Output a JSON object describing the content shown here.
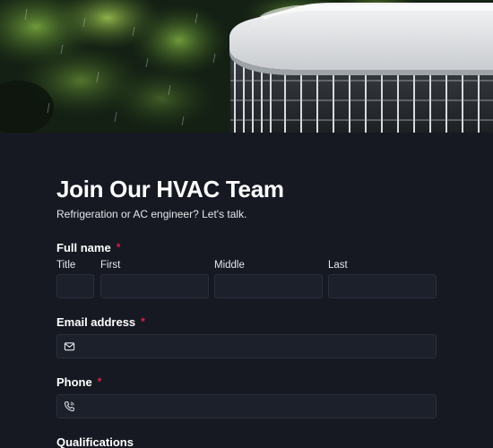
{
  "form": {
    "title": "Join Our HVAC Team",
    "subtitle": "Refrigeration or AC engineer? Let's talk.",
    "required_mark": "*",
    "full_name": {
      "label": "Full name",
      "sublabels": {
        "title": "Title",
        "first": "First",
        "middle": "Middle",
        "last": "Last"
      },
      "values": {
        "title": "",
        "first": "",
        "middle": "",
        "last": ""
      }
    },
    "email": {
      "label": "Email address",
      "icon": "envelope-icon",
      "value": ""
    },
    "phone": {
      "label": "Phone",
      "icon": "phone-icon",
      "value": ""
    },
    "qualifications": {
      "label": "Qualifications"
    }
  },
  "colors": {
    "background": "#161922",
    "input_background": "#1c202a",
    "input_border": "#2a2f3b",
    "required": "#d81f4a",
    "text": "#ffffff"
  }
}
